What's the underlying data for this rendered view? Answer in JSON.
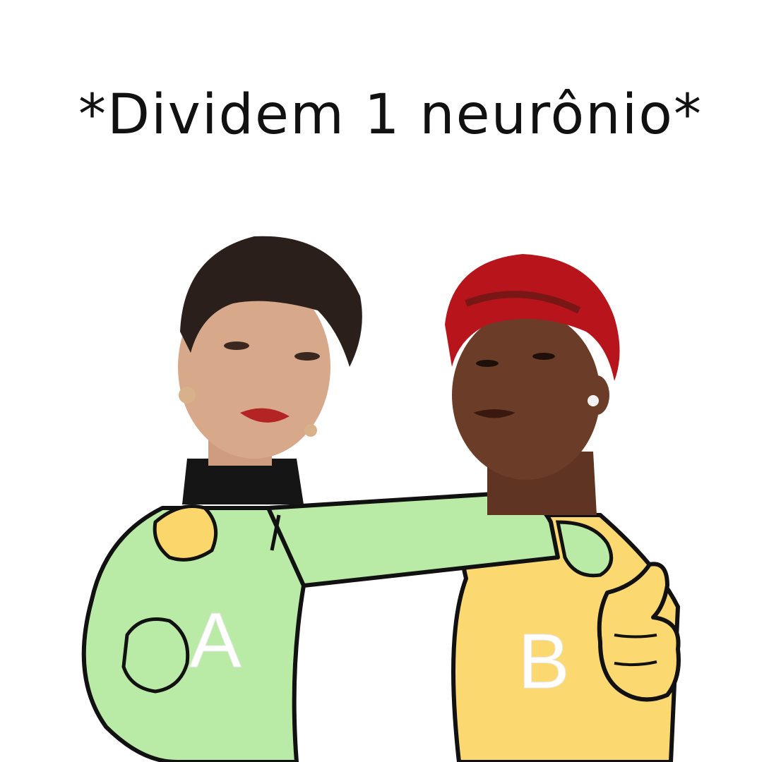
{
  "caption": "*Dividem 1 neurônio*",
  "characters": [
    {
      "letter": "A",
      "shirt_color": "#b9eaa6",
      "hand_color": "#fbd66b"
    },
    {
      "letter": "B",
      "shirt_color": "#fcd870",
      "hand_color": "#fcd870"
    }
  ],
  "colors": {
    "background": "#ffffff",
    "outline": "#111111",
    "hair_dark": "#2a1f1a",
    "hair_red": "#b8141c",
    "skin_light": "#d8a88a",
    "skin_dark": "#6b3d28",
    "turtleneck": "#151515"
  }
}
